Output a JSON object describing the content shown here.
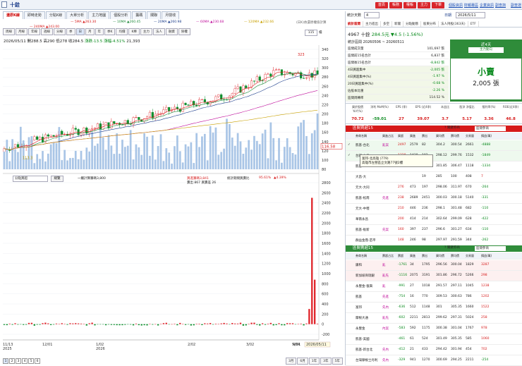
{
  "title": {
    "symbol": "十銓"
  },
  "top_buttons": [
    {
      "label": "首頁",
      "color": "#d9262c"
    },
    {
      "label": "帳務",
      "color": "#d9262c"
    },
    {
      "label": "權帳",
      "color": "#d9262c"
    },
    {
      "label": "主力",
      "color": "#d9262c"
    },
    {
      "label": "下單",
      "color": "#d9262c"
    }
  ],
  "top_links": [
    "個股資訊",
    "財報專區",
    "企業資訊",
    "副查詢",
    "副查證"
  ],
  "tabs": [
    "還原K線",
    "即時走勢",
    "分點K線",
    "大單分析",
    "主力地圖",
    "個股分析",
    "籌碼",
    "關聯",
    "月營收"
  ],
  "ma_legend": [
    {
      "label": "5MA ▲263.30",
      "color": "#d61a1a"
    },
    {
      "label": "10MA ▲260.45",
      "color": "#1f8a3a"
    },
    {
      "label": "20MA ▲260.98",
      "color": "#1b3c8a"
    },
    {
      "label": "60MA ▲230.68",
      "color": "#c0109c"
    },
    {
      "label": "120MA ▲232.66",
      "color": "#c8a000"
    },
    {
      "label": "240MA ▲243.00",
      "color": "#d61a1a"
    }
  ],
  "ma_note": "(日K)依還原權值計算",
  "period_btns": [
    "周線",
    "月線",
    "年線",
    "週線",
    "分線",
    "季",
    "日",
    "月",
    "年",
    "季K"
  ],
  "extra_btns": [
    "均價",
    "K棒",
    "主力",
    "法人",
    "融資",
    "除權"
  ],
  "zoom": {
    "label": "115",
    "unit": "檔"
  },
  "ohlc": {
    "date": "2026/05/11",
    "open_label": "開",
    "open": "288.5",
    "high_label": "高",
    "high": "290",
    "low_label": "低",
    "low": "278",
    "close_label": "收",
    "close": "284.5",
    "chg_label": "漲跌",
    "chg": "-13.5",
    "pct_label": "漲幅",
    "pct": "-4.51%",
    "vol": "21,393"
  },
  "price_axis": [
    "340",
    "320",
    "300",
    "280",
    "260",
    "240",
    "220",
    "200",
    "180",
    "160",
    "140",
    "120",
    "100",
    "80"
  ],
  "price_marks": {
    "high": "323",
    "low": "113.3",
    "right": "116.58"
  },
  "indicator": {
    "select": "分點買超",
    "btn": "總覽",
    "left_label": "一觸計算籌碼3,800",
    "mid_label": "買進籌碼3,841",
    "mid2_label": "賣出 867  買賣差 26",
    "right_label": "統計期間買賣比",
    "right_val": "95.61%",
    "right2": "▲4.39%"
  },
  "ind_axis": [
    "2800",
    "2600",
    "2400",
    "2200",
    "2000",
    "1800",
    "1600",
    "1400",
    "1200",
    "1000",
    "800",
    "600",
    "400",
    "200",
    "0",
    "-200"
  ],
  "x_axis": [
    "11/13",
    "12/01",
    "1/02",
    "2/02",
    "3/02",
    "4/01",
    "5/04"
  ],
  "x_axis_years": [
    {
      "i": 0,
      "y": "2025"
    },
    {
      "i": 2,
      "y": "2026"
    }
  ],
  "x_current": "2026/05/11",
  "paging": [
    "1",
    "2",
    "3",
    "4",
    "5",
    "6"
  ],
  "range_btns": [
    "3月",
    "6月",
    "1年",
    "3年",
    "5年"
  ],
  "chart_data": {
    "type": "candlestick",
    "x": [
      "11/13",
      "12/01",
      "1/02",
      "2/02",
      "3/02",
      "4/01",
      "5/04",
      "5/11"
    ],
    "close": [
      125,
      150,
      170,
      190,
      215,
      240,
      290,
      284.5
    ],
    "high_marker": 323,
    "low_marker": 113.3,
    "volume_last": 21393,
    "indicator_values": [
      20,
      15,
      -30,
      10,
      40,
      -60,
      300,
      2500,
      880
    ]
  },
  "rp": {
    "date": "2026/5/11",
    "days": "4",
    "unit": "統計天數",
    "tabs": [
      "統計區間",
      "主力進出",
      "多空",
      "新聞",
      "分點動態",
      "股東分布",
      "法人持股(363天)",
      "ETF"
    ],
    "stock": {
      "code": "4967",
      "name": "十銓",
      "price": "284.5元",
      "chg": "▼4.5 (-1.56%)"
    },
    "period_label": "統計區間 20260506 ~ 20260511",
    "stats": [
      {
        "k": "區間成交量",
        "v": "101,697 張"
      },
      {
        "k": "區間前15名合計",
        "v": "6,837 張"
      },
      {
        "k": "區間後15名合計",
        "v": "-8,842 張"
      },
      {
        "k": "4日買超集中",
        "v": "-2,005 張"
      },
      {
        "k": "4日買超集中(%)",
        "v": "-1.97 %"
      },
      {
        "k": "20日買超集中(%)",
        "v": "-0.68 %"
      },
      {
        "k": "佔股本比重",
        "v": "-2.26 %"
      },
      {
        "k": "區間周轉率",
        "v": "114.52 %"
      }
    ],
    "summary": {
      "header": "近4天",
      "badge": "主力動向",
      "label": "小賣",
      "amount": "2,005 張"
    },
    "kpi_heads": [
      "買於股價 YoY(%)",
      "淨利 MoM(%)",
      "EPS (季)",
      "EPS (近4季)",
      "本益比",
      "股淨 淨值比",
      "殖利率(%)",
      "ROE(近4季)"
    ],
    "kpi_vals": [
      "70.72",
      "-59.01",
      "27",
      "39.07",
      "3.7",
      "5.17",
      "3.36",
      "46.8"
    ],
    "buy": {
      "title": "區間買超15",
      "filter": "關鍵券商",
      "select": "區間參商",
      "heads": [
        "",
        "券商名稱",
        "買進占比",
        "買超",
        "買進",
        "賣出",
        "買均價",
        "賣均價",
        "交易量",
        "損益(萬)"
      ],
      "rows": [
        [
          "✓",
          "凱基-台北",
          "亂案",
          "2497",
          "2579",
          "82",
          "304.2",
          "300.54",
          "2661",
          "-4888"
        ],
        [
          "✓",
          "台新-大昌",
          "",
          "1328",
          "1430",
          "102",
          "298.12",
          "299.76",
          "1532",
          "-1849"
        ],
        [
          "",
          "凱基-",
          "",
          "",
          "",
          "",
          "",
          "",
          "",
          ""
        ],
        [
          "",
          "大昌-大",
          "",
          "",
          "",
          "",
          "",
          "",
          "",
          ""
        ],
        [
          "",
          "元大-大同",
          "",
          "276",
          "473",
          "197",
          "298.06",
          "311.97",
          "670",
          "-264"
        ],
        [
          "",
          "凱基-松南",
          "先進",
          "238",
          "2689",
          "2451",
          "300.03",
          "300.18",
          "5140",
          "-331"
        ],
        [
          "",
          "元大-中壢",
          "",
          "210",
          "446",
          "236",
          "298.1",
          "301.48",
          "682",
          "-110"
        ],
        [
          "",
          "華南永昌",
          "",
          "200",
          "414",
          "214",
          "302.64",
          "299.09",
          "628",
          "-422"
        ],
        [
          "",
          "凱基-板新",
          "先案",
          "160",
          "397",
          "237",
          "296.6",
          "301.27",
          "634",
          "-110"
        ],
        [
          "",
          "群益金鼎-苗平",
          "",
          "148",
          "246",
          "98",
          "297.97",
          "291.59",
          "344",
          "-262"
        ]
      ],
      "tooltip1": "富邦-北高雄 (779)",
      "tooltip2": "高雄市左營區立文路77號2樓",
      "tt_rows": [
        [
          "153",
          "301.85",
          "306.47",
          "1118",
          "-1334"
        ],
        [
          "19",
          "285",
          "100",
          "408",
          "7"
        ]
      ]
    },
    "sell": {
      "title": "區間賣超15",
      "filter": "關鍵券商",
      "select": "區間參商",
      "heads": [
        "",
        "券商名稱",
        "賣超占比",
        "賣超",
        "買進",
        "賣出",
        "買均價",
        "賣均價",
        "交易量",
        "損益(萬)"
      ],
      "rows": [
        [
          "",
          "康和",
          "亂",
          "-1761",
          "34",
          "1795",
          "296.56",
          "300.04",
          "1829",
          "3287"
        ],
        [
          "",
          "新加坡商瑞銀",
          "亂先",
          "-1116",
          "2075",
          "3191",
          "301.86",
          "296.72",
          "5266",
          "298"
        ],
        [
          "",
          "永豐金-復興",
          "亂",
          "-991",
          "27",
          "1018",
          "291.57",
          "297.11",
          "1045",
          "1238"
        ],
        [
          "",
          "凱基",
          "先進",
          "-754",
          "16",
          "770",
          "309.53",
          "300.63",
          "786",
          "1202"
        ],
        [
          "",
          "富邦",
          "先內",
          "-636",
          "512",
          "1148",
          "301",
          "305.35",
          "1660",
          "1522"
        ],
        [
          "",
          "摩根大通",
          "亂先",
          "-602",
          "2211",
          "2813",
          "299.62",
          "297.31",
          "5024",
          "258"
        ],
        [
          "",
          "永豐金",
          "內案",
          "-583",
          "592",
          "1175",
          "300.38",
          "301.04",
          "1767",
          "978"
        ],
        [
          "",
          "凱基-美國",
          "",
          "-461",
          "61",
          "524",
          "301.49",
          "305.35",
          "585",
          "1060"
        ],
        [
          "",
          "凱基-新台北",
          "先內",
          "-412",
          "21",
          "433",
          "294.42",
          "301.94",
          "454",
          "702"
        ],
        [
          "",
          "台灣摩根士丹利",
          "先內",
          "-329",
          "941",
          "1270",
          "300.69",
          "294.25",
          "2211",
          "-254"
        ]
      ]
    }
  }
}
